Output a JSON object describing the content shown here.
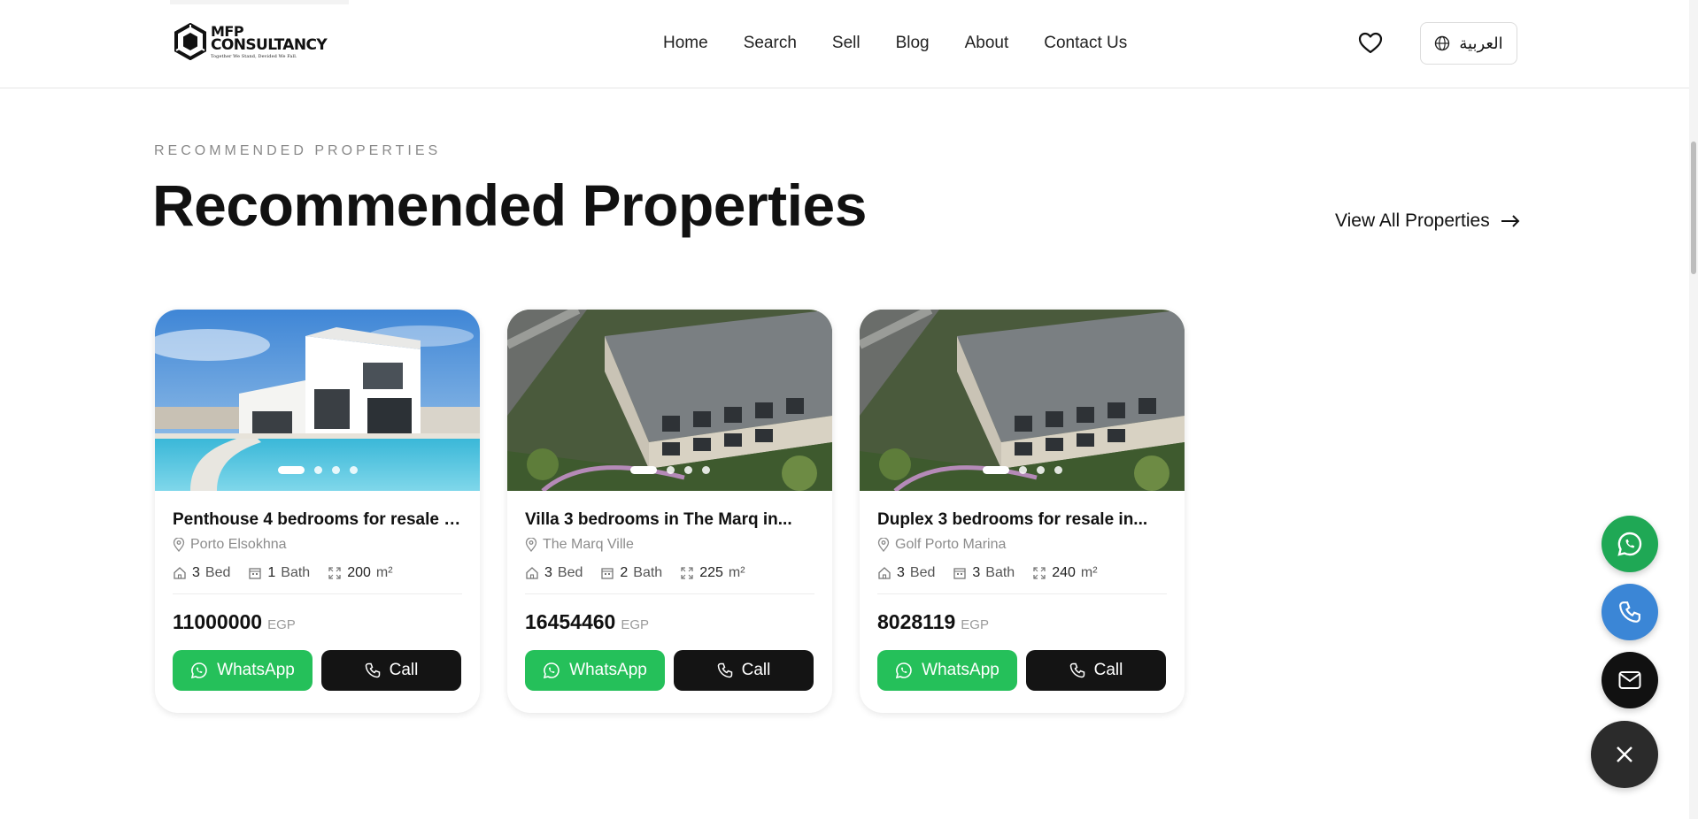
{
  "header": {
    "logo": {
      "line1": "MFP",
      "line2": "CONSULTANCY",
      "tagline": "Together We Stand, Devided We Fall."
    },
    "nav": [
      {
        "label": "Home"
      },
      {
        "label": "Search"
      },
      {
        "label": "Sell"
      },
      {
        "label": "Blog"
      },
      {
        "label": "About"
      },
      {
        "label": "Contact Us"
      }
    ],
    "favorites_icon": "heart-icon",
    "language_button": {
      "label": "العربية",
      "icon": "globe-icon"
    }
  },
  "section": {
    "eyebrow": "RECOMMENDED PROPERTIES",
    "title": "Recommended Properties",
    "view_all": "View All Properties"
  },
  "cards": [
    {
      "title": "Penthouse 4 bedrooms for resale i...",
      "location": "Porto Elsokhna",
      "beds": "3",
      "beds_label": "Bed",
      "baths": "1",
      "baths_label": "Bath",
      "area": "200",
      "area_unit": "m²",
      "price": "11000000",
      "currency": "EGP",
      "whatsapp_label": "WhatsApp",
      "call_label": "Call",
      "image_dots": 4,
      "active_dot": 0
    },
    {
      "title": "Villa 3 bedrooms in The Marq in...",
      "location": "The Marq Ville",
      "beds": "3",
      "beds_label": "Bed",
      "baths": "2",
      "baths_label": "Bath",
      "area": "225",
      "area_unit": "m²",
      "price": "16454460",
      "currency": "EGP",
      "whatsapp_label": "WhatsApp",
      "call_label": "Call",
      "image_dots": 4,
      "active_dot": 0
    },
    {
      "title": "Duplex 3 bedrooms for resale in...",
      "location": "Golf Porto Marina",
      "beds": "3",
      "beds_label": "Bed",
      "baths": "3",
      "baths_label": "Bath",
      "area": "240",
      "area_unit": "m²",
      "price": "8028119",
      "currency": "EGP",
      "whatsapp_label": "WhatsApp",
      "call_label": "Call",
      "image_dots": 4,
      "active_dot": 0
    }
  ],
  "floating_actions": [
    {
      "icon": "whatsapp-icon",
      "color": "#1fa855"
    },
    {
      "icon": "phone-icon",
      "color": "#3b86d6"
    },
    {
      "icon": "mail-icon",
      "color": "#111111"
    },
    {
      "icon": "close-icon",
      "color": "#2b2b2b"
    }
  ],
  "colors": {
    "whatsapp_green": "#25c05a",
    "dark": "#141414",
    "muted": "#8c8c8c"
  }
}
